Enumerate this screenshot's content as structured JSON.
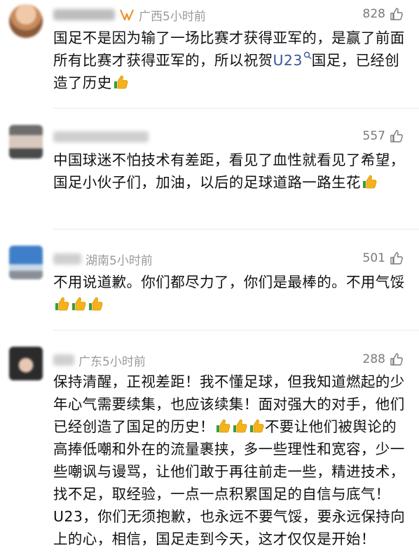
{
  "comments": [
    {
      "location": "广西",
      "time": "5小时前",
      "likes": "828",
      "text_before": "国足不是因为输了一场比赛才获得亚军的，是赢了前面所有比赛才获得亚军的，所以祝贺",
      "topic": "U23",
      "text_after": "国足，已经创造了历史"
    },
    {
      "likes": "557",
      "text": "中国球迷不怕技术有差距，看见了血性就看见了希望，国足小伙子们，加油，以后的足球道路一路生花"
    },
    {
      "location": "湖南",
      "time": "5小时前",
      "likes": "501",
      "text": "不用说道歉。你们都尽力了，你们是最棒的。不用气馁"
    },
    {
      "location": "广东",
      "time": "5小时前",
      "likes": "288",
      "text_before": "保持清醒，正视差距！我不懂足球，但我知道燃起的少年心气需要续集，也应该续集！面对强大的对手，他们已经创造了国足的历史！",
      "text_after": "不要让他们被舆论的高捧低嘲和外在的流量裹挟，多一些理性和宽容，少一些嘲讽与谩骂，让他们敢于再往前走一些，精进技术，找不足，取经验，一点一点积累国足的自信与底气！U23，你们无须抱歉，也永远不要气馁，要永远保持向上的心，相信，国足走到今天，这才仅仅是开始！"
    }
  ],
  "icons": {
    "like": "thumbs-up-outline-icon",
    "emoji": "thumbs-up-emoji-icon",
    "badge": "orange-badge-icon",
    "topic": "search-icon"
  },
  "colors": {
    "topic": "#3b5998",
    "meta": "#9a9a9a",
    "emoji": "#f5b21a"
  }
}
